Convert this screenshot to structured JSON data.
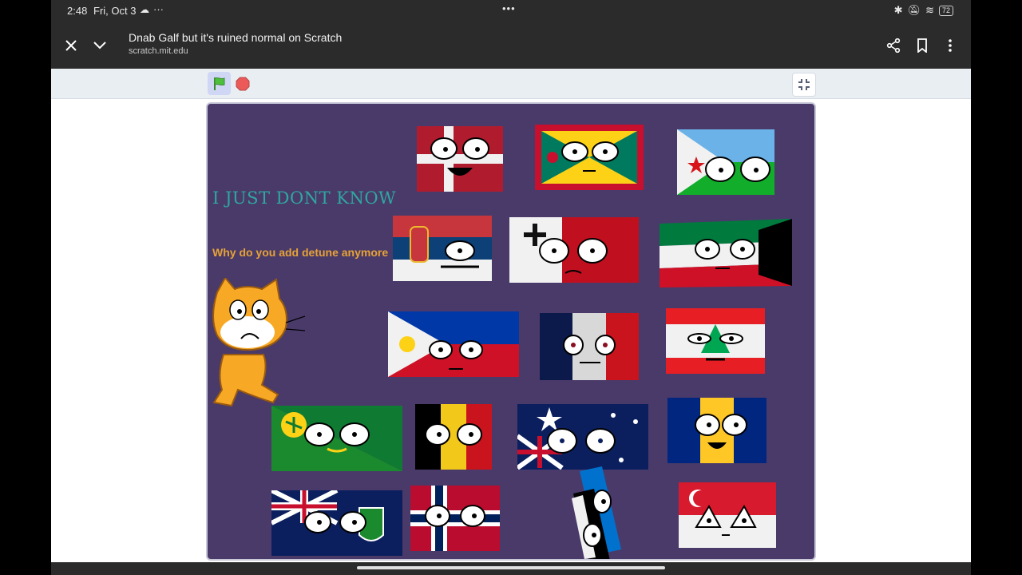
{
  "status": {
    "time": "2:48",
    "date": "Fri, Oct 3",
    "battery": "72"
  },
  "browser": {
    "page_title": "Dnab Galf but it's ruined normal on Scratch",
    "url": "scratch.mit.edu"
  },
  "stage": {
    "title": "I JUST DONT KNOW",
    "subtitle": "Why do you add detune anymore"
  },
  "colors": {
    "stage_bg": "#4a3a6a",
    "title_color": "#2fa7a0",
    "subtitle_color": "#e6a236"
  },
  "sprites": [
    "denmark-flag",
    "grenada-flag",
    "djibouti-flag",
    "serbia-flag",
    "malta-flag",
    "kuwait-flag",
    "philippines-flag",
    "france-flag",
    "lebanon-flag",
    "christmas-island-flag",
    "belgium-flag",
    "australia-flag",
    "barbados-flag",
    "montserrat-flag",
    "norway-flag",
    "estonia-flag",
    "singapore-flag",
    "scratch-cat"
  ]
}
